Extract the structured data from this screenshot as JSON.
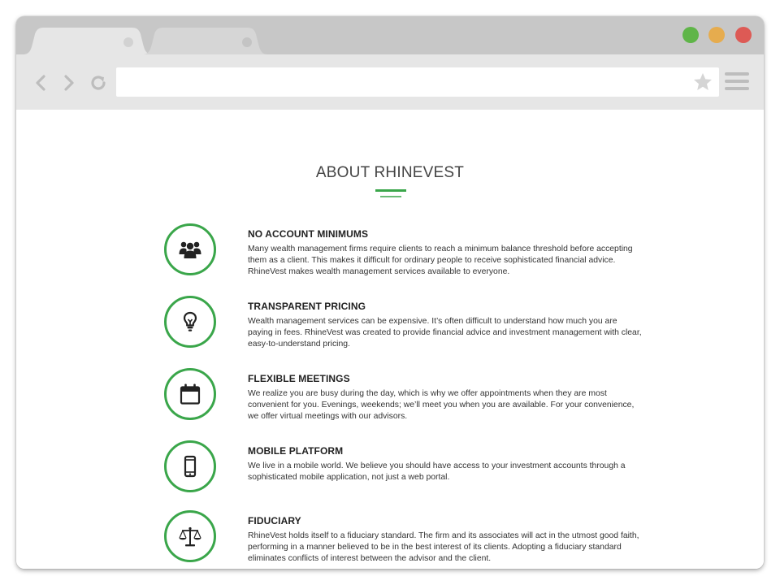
{
  "browser": {
    "tabs": [
      {
        "state": "active"
      },
      {
        "state": "inactive"
      }
    ],
    "window_controls": [
      {
        "name": "maximize",
        "color": "#5fb548"
      },
      {
        "name": "minimize",
        "color": "#e6ac4e"
      },
      {
        "name": "close",
        "color": "#dd5a55"
      }
    ],
    "nav_icons": [
      "back-icon",
      "forward-icon",
      "reload-icon"
    ],
    "address_value": "",
    "bookmark_icon": "star-icon",
    "menu_icon": "hamburger-icon"
  },
  "page": {
    "title": "ABOUT RHINEVEST",
    "accent_color": "#3aa64a",
    "features": [
      {
        "icon": "group-icon",
        "title": "NO ACCOUNT MINIMUMS",
        "body": "Many wealth management firms require clients to reach a minimum balance threshold before accepting them as a client. This makes it difficult for ordinary people to receive sophisticated financial advice. RhineVest makes wealth management services available to everyone."
      },
      {
        "icon": "lightbulb-icon",
        "title": "TRANSPARENT PRICING",
        "body": "Wealth management services can be expensive. It’s often difficult to understand how much you are paying in fees. RhineVest was created to provide financial advice and investment management with clear, easy-to-understand pricing."
      },
      {
        "icon": "calendar-icon",
        "title": "FLEXIBLE MEETINGS",
        "body": "We realize you are busy during the day, which is why we offer appointments when they are most convenient for you. Evenings, weekends; we’ll meet you when you are available. For your convenience, we offer virtual meetings with our advisors."
      },
      {
        "icon": "mobile-phone-icon",
        "title": "MOBILE PLATFORM",
        "body": "We live in a mobile world. We believe you should have access to your investment accounts through a sophisticated mobile application, not just a web portal."
      },
      {
        "icon": "scales-icon",
        "title": "FIDUCIARY",
        "body": "RhineVest holds itself to a fiduciary standard. The firm and its associates will act in the utmost good faith, performing in a manner believed to be in the best interest of its clients. Adopting a fiduciary standard eliminates conflicts of interest between the advisor and the client."
      }
    ]
  }
}
